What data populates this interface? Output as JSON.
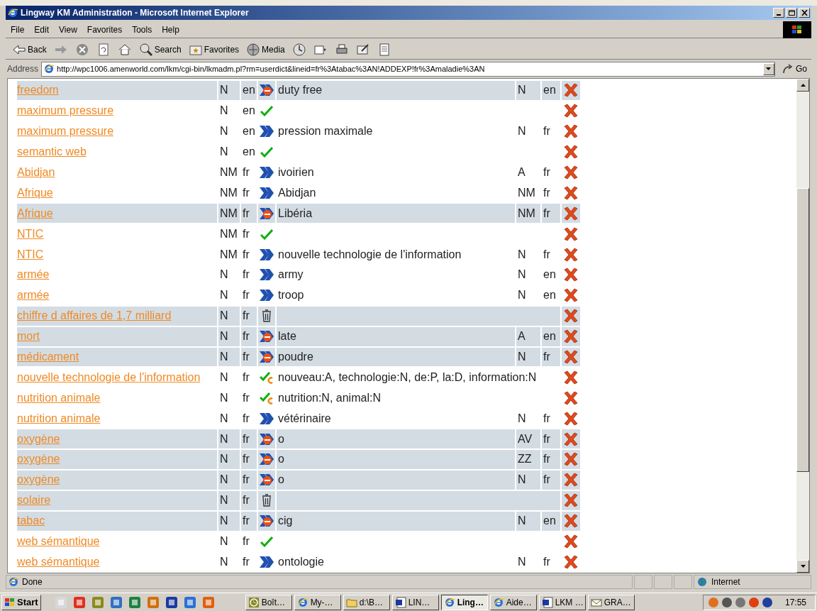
{
  "window": {
    "title": "Lingway KM Administration - Microsoft Internet Explorer"
  },
  "menu": [
    "File",
    "Edit",
    "View",
    "Favorites",
    "Tools",
    "Help"
  ],
  "toolbar": [
    {
      "kind": "back",
      "label": "Back"
    },
    {
      "kind": "forward"
    },
    {
      "kind": "stop"
    },
    {
      "kind": "refresh"
    },
    {
      "kind": "home"
    },
    {
      "kind": "search",
      "label": "Search"
    },
    {
      "kind": "favorites",
      "label": "Favorites"
    },
    {
      "kind": "media",
      "label": "Media"
    },
    {
      "kind": "history"
    },
    {
      "kind": "mail"
    },
    {
      "kind": "print"
    },
    {
      "kind": "edit"
    },
    {
      "kind": "discuss"
    }
  ],
  "address": {
    "label": "Address",
    "value": "http://wpc1006.amenworld.com/lkm/cgi-bin/lkmadm.pl?rm=userdict&lineid=fr%3Atabac%3AN!ADDEXP!fr%3Amaladie%3AN",
    "go": "Go"
  },
  "rows": [
    {
      "term": "freedom",
      "pos": "N",
      "lang": "en",
      "kind": "stop-arrow",
      "target": "duty free",
      "tpos": "N",
      "tlang": "en",
      "highlighted": true
    },
    {
      "term": "maximum pressure",
      "pos": "N",
      "lang": "en",
      "kind": "check",
      "highlighted": false
    },
    {
      "term": "maximum pressure",
      "pos": "N",
      "lang": "en",
      "kind": "arrow",
      "target": "pression maximale",
      "tpos": "N",
      "tlang": "fr",
      "highlighted": false
    },
    {
      "term": "semantic web",
      "pos": "N",
      "lang": "en",
      "kind": "check",
      "highlighted": false
    },
    {
      "term": "Abidjan",
      "pos": "NM",
      "lang": "fr",
      "kind": "arrow",
      "target": "ivoirien",
      "tpos": "A",
      "tlang": "fr",
      "highlighted": false
    },
    {
      "term": "Afrique",
      "pos": "NM",
      "lang": "fr",
      "kind": "arrow",
      "target": "Abidjan",
      "tpos": "NM",
      "tlang": "fr",
      "highlighted": false
    },
    {
      "term": "Afrique",
      "pos": "NM",
      "lang": "fr",
      "kind": "stop-arrow",
      "target": "Libéria",
      "tpos": "NM",
      "tlang": "fr",
      "highlighted": true
    },
    {
      "term": "NTIC",
      "pos": "NM",
      "lang": "fr",
      "kind": "check",
      "highlighted": false
    },
    {
      "term": "NTIC",
      "pos": "NM",
      "lang": "fr",
      "kind": "arrow",
      "target": "nouvelle technologie de l'information",
      "tpos": "N",
      "tlang": "fr",
      "highlighted": false
    },
    {
      "term": "armée",
      "pos": "N",
      "lang": "fr",
      "kind": "arrow",
      "target": "army",
      "tpos": "N",
      "tlang": "en",
      "highlighted": false
    },
    {
      "term": "armée",
      "pos": "N",
      "lang": "fr",
      "kind": "arrow",
      "target": "troop",
      "tpos": "N",
      "tlang": "en",
      "highlighted": false
    },
    {
      "term": "chiffre d affaires de 1,7 milliard",
      "pos": "N",
      "lang": "fr",
      "kind": "trash",
      "highlighted": true
    },
    {
      "term": "mort",
      "pos": "N",
      "lang": "fr",
      "kind": "stop-arrow",
      "target": "late",
      "tpos": "A",
      "tlang": "en",
      "highlighted": true
    },
    {
      "term": "médicament",
      "pos": "N",
      "lang": "fr",
      "kind": "stop-arrow",
      "target": "poudre",
      "tpos": "N",
      "tlang": "fr",
      "highlighted": true
    },
    {
      "term": "nouvelle technologie de l'information",
      "pos": "N",
      "lang": "fr",
      "kind": "check-c",
      "target": "nouveau:A, technologie:N, de:P, la:D, information:N",
      "highlighted": false
    },
    {
      "term": "nutrition animale",
      "pos": "N",
      "lang": "fr",
      "kind": "check-c",
      "target": "nutrition:N, animal:N",
      "highlighted": false
    },
    {
      "term": "nutrition animale",
      "pos": "N",
      "lang": "fr",
      "kind": "arrow",
      "target": "vétérinaire",
      "tpos": "N",
      "tlang": "fr",
      "highlighted": false
    },
    {
      "term": "oxygène",
      "pos": "N",
      "lang": "fr",
      "kind": "stop-arrow",
      "target": "o",
      "tpos": "AV",
      "tlang": "fr",
      "highlighted": true
    },
    {
      "term": "oxygène",
      "pos": "N",
      "lang": "fr",
      "kind": "stop-arrow",
      "target": "o",
      "tpos": "ZZ",
      "tlang": "fr",
      "highlighted": true
    },
    {
      "term": "oxygène",
      "pos": "N",
      "lang": "fr",
      "kind": "stop-arrow",
      "target": "o",
      "tpos": "N",
      "tlang": "fr",
      "highlighted": true
    },
    {
      "term": "solaire",
      "pos": "N",
      "lang": "fr",
      "kind": "trash",
      "highlighted": true
    },
    {
      "term": "tabac",
      "pos": "N",
      "lang": "fr",
      "kind": "stop-arrow",
      "target": "cig",
      "tpos": "N",
      "tlang": "en",
      "highlighted": true
    },
    {
      "term": "web sémantique",
      "pos": "N",
      "lang": "fr",
      "kind": "check",
      "highlighted": false
    },
    {
      "term": "web sémantique",
      "pos": "N",
      "lang": "fr",
      "kind": "arrow",
      "target": "ontologie",
      "tpos": "N",
      "tlang": "fr",
      "highlighted": false
    }
  ],
  "status_bar": {
    "text": "Done",
    "zone": "Internet"
  },
  "taskbar": {
    "start": "Start",
    "tasks": [
      {
        "kind": "clock",
        "label": "Boît…",
        "selected": false
      },
      {
        "kind": "ie",
        "label": "My-…",
        "selected": false
      },
      {
        "kind": "folder",
        "label": "d:\\B…",
        "selected": false
      },
      {
        "kind": "word",
        "label": "LIN…",
        "selected": false
      },
      {
        "kind": "ie",
        "label": "Ling…",
        "selected": true
      },
      {
        "kind": "ie",
        "label": "Aide…",
        "selected": false
      },
      {
        "kind": "word",
        "label": "LKM …",
        "selected": false
      },
      {
        "kind": "mail",
        "label": "GRA…",
        "selected": false
      }
    ],
    "clock": "17:55"
  }
}
